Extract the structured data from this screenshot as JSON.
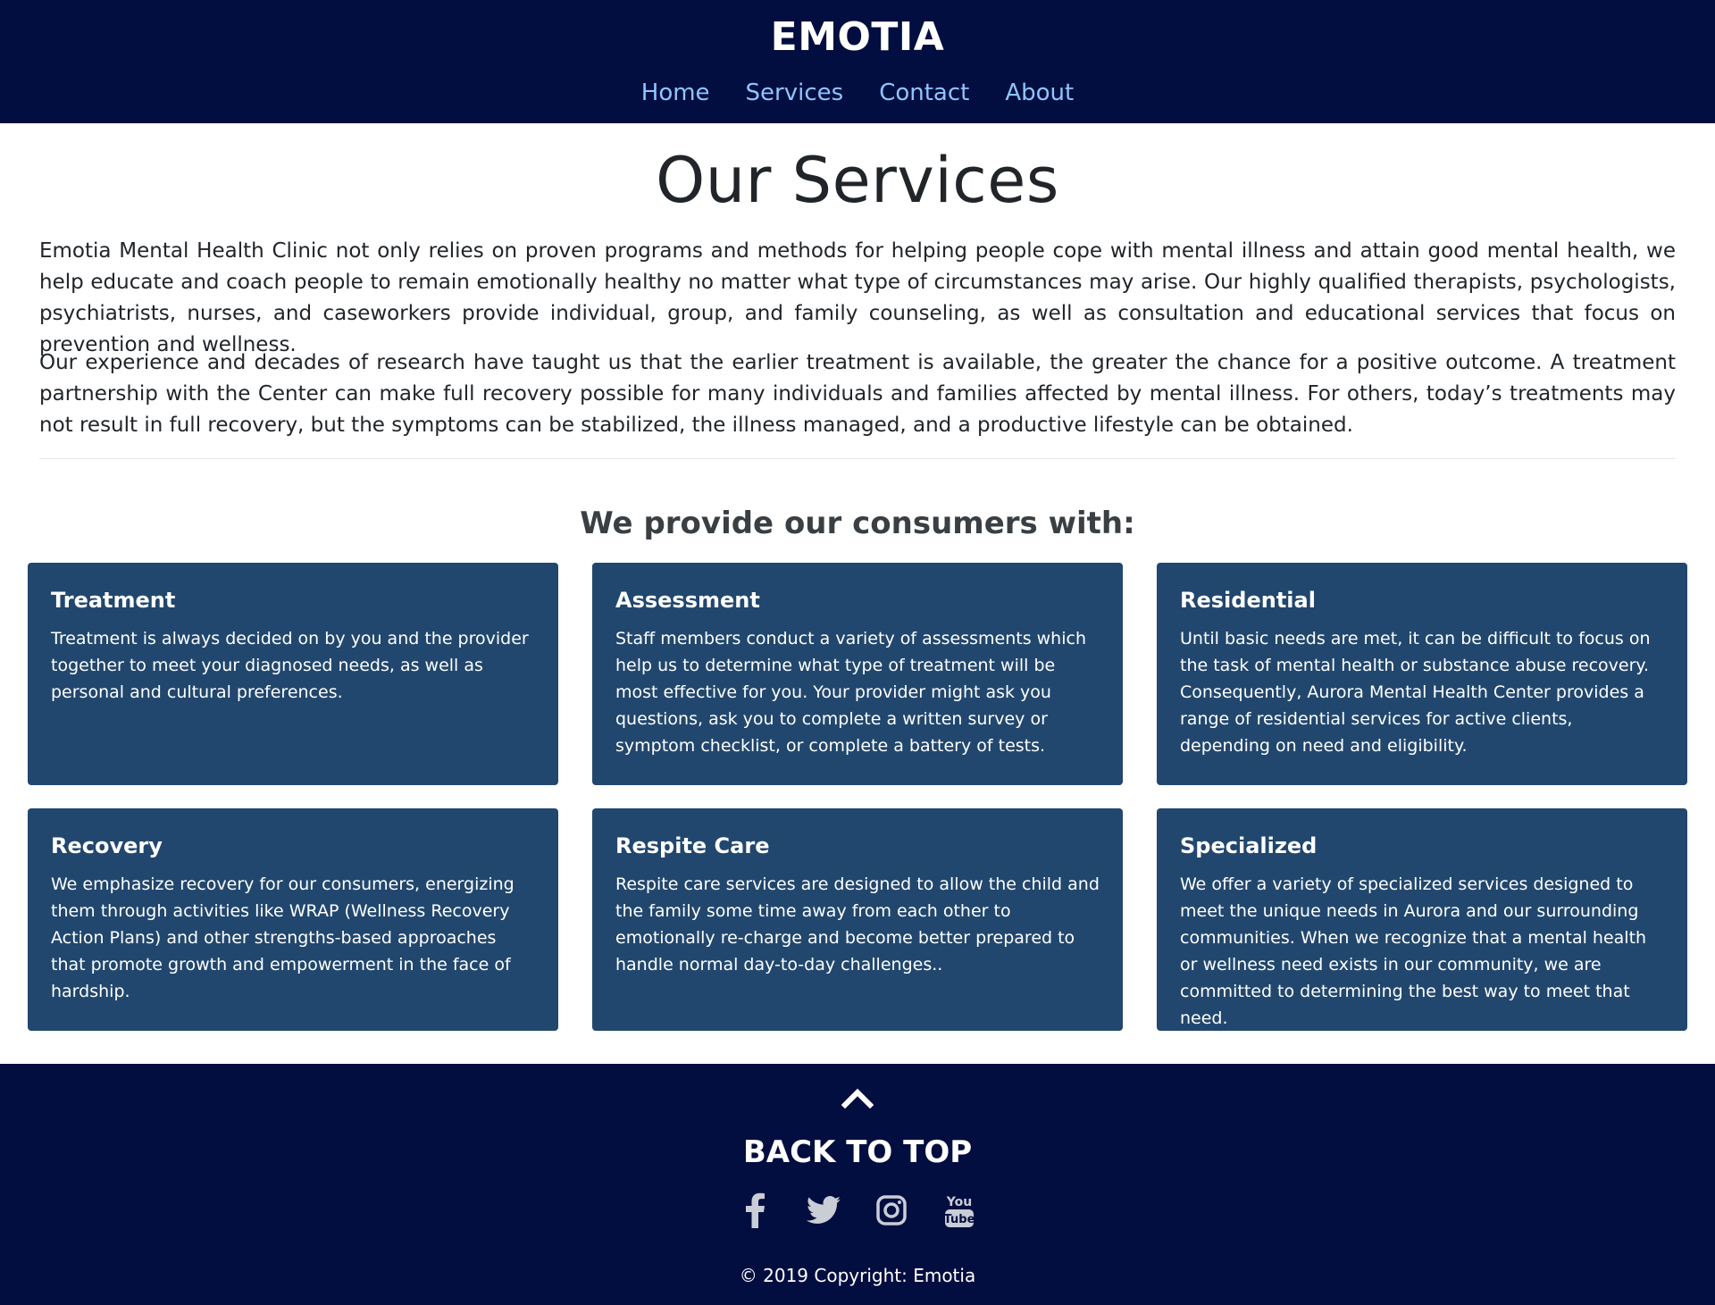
{
  "header": {
    "brand": "EMOTIA",
    "nav": [
      "Home",
      "Services",
      "Contact",
      "About"
    ]
  },
  "main": {
    "title": "Our Services",
    "paragraphs": [
      "Emotia Mental Health Clinic not only relies on proven programs and methods for helping people cope with mental illness and attain good mental health, we help educate and coach people to remain emotionally healthy no matter what type of circumstances may arise. Our highly qualified therapists, psychologists, psychiatrists, nurses, and caseworkers provide individual, group, and family counseling, as well as consultation and educational services that focus on prevention and wellness.",
      "Our experience and decades of research have taught us that the earlier treatment is available, the greater the chance for a positive outcome. A treatment partnership with the Center can make full recovery possible for many individuals and families affected by mental illness. For others, today’s treatments may not result in full recovery, but the symptoms can be stabilized, the illness managed, and a productive lifestyle can be obtained."
    ],
    "subheading": "We provide our consumers with:",
    "cards": [
      {
        "title": "Treatment",
        "text": "Treatment is always decided on by you and the provider together to meet your diagnosed needs, as well as personal and cultural preferences."
      },
      {
        "title": "Assessment",
        "text": "Staff members conduct a variety of assessments which help us to determine what type of treatment will be most effective for you. Your provider might ask you questions, ask you to complete a written survey or symptom checklist, or complete a battery of tests."
      },
      {
        "title": "Residential",
        "text": "Until basic needs are met, it can be difficult to focus on the task of mental health or substance abuse recovery. Consequently, Aurora Mental Health Center provides a range of residential services for active clients, depending on need and eligibility."
      },
      {
        "title": "Recovery",
        "text": "We emphasize recovery for our consumers, energizing them through activities like WRAP (Wellness Recovery Action Plans) and other strengths-based approaches that promote growth and empowerment in the face of hardship."
      },
      {
        "title": "Respite Care",
        "text": "Respite care services are designed to allow the child and the family some time away from each other to emotionally re-charge and become better prepared to handle normal day-to-day challenges.."
      },
      {
        "title": "Specialized",
        "text": "We offer a variety of specialized services designed to meet the unique needs in Aurora and our surrounding communities. When we recognize that a mental health or wellness need exists in our community, we are committed to determining the best way to meet that need."
      }
    ]
  },
  "footer": {
    "back_to_top": "BACK TO TOP",
    "socials": [
      "facebook-icon",
      "twitter-icon",
      "instagram-icon",
      "youtube-icon"
    ],
    "youtube_top": "You",
    "youtube_bottom": "Tube",
    "copyright": "© 2019 Copyright: Emotia"
  },
  "colors": {
    "header_bg": "#030e40",
    "card_bg": "#21476e",
    "nav_link": "#8ec5ff"
  }
}
